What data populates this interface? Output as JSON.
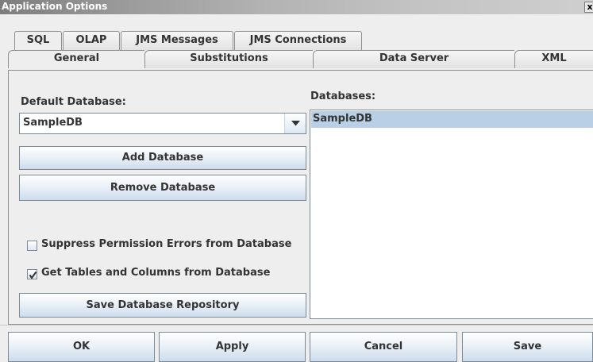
{
  "window": {
    "title": "Application Options",
    "close_glyph": "x"
  },
  "tabs_row1": [
    "SQL",
    "OLAP",
    "JMS Messages",
    "JMS Connections"
  ],
  "tabs_row2": [
    "General",
    "Substitutions",
    "Data Server",
    "XML"
  ],
  "selected_tab_row1": "SQL",
  "selected_tab_row2": "General",
  "default_database": {
    "label": "Default Database:",
    "selected_value": "SampleDB"
  },
  "buttons": {
    "add_database": "Add Database",
    "remove_database": "Remove Database",
    "save_repository": "Save Database Repository"
  },
  "checkboxes": [
    {
      "label": "Suppress Permission Errors from Database",
      "checked": false
    },
    {
      "label": "Get Tables and Columns from Database",
      "checked": true
    }
  ],
  "databases": {
    "label": "Databases:",
    "items": [
      "SampleDB"
    ],
    "selected_index": 0
  },
  "footer_buttons": [
    "OK",
    "Apply",
    "Cancel",
    "Save"
  ],
  "colors": {
    "selection": "#b8cfe5",
    "background": "#eeeeee",
    "border": "#8e8f8f"
  }
}
